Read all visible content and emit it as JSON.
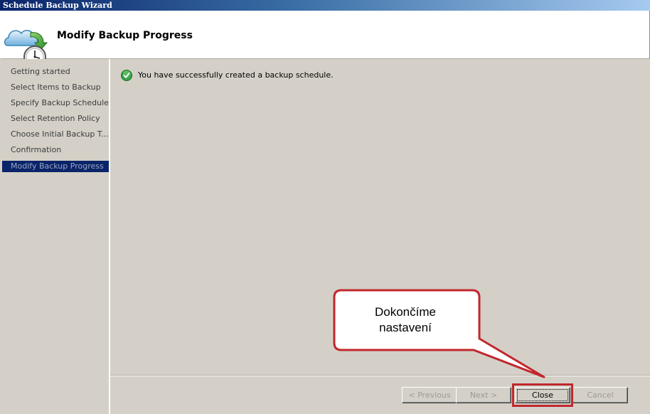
{
  "window": {
    "title": "Schedule Backup Wizard"
  },
  "header": {
    "title": "Modify Backup Progress",
    "icon": "backup-clock-icon"
  },
  "sidebar": {
    "items": [
      {
        "label": "Getting started"
      },
      {
        "label": "Select Items to Backup"
      },
      {
        "label": "Specify Backup Schedule"
      },
      {
        "label": "Select Retention Policy"
      },
      {
        "label": "Choose Initial Backup T..."
      },
      {
        "label": "Confirmation"
      },
      {
        "label": "Modify Backup Progress",
        "active": true
      }
    ]
  },
  "content": {
    "status_icon": "success-check-icon",
    "message": "You have successfully created a backup schedule."
  },
  "buttons": {
    "previous": "< Previous",
    "next": "Next >",
    "close": "Close",
    "cancel": "Cancel"
  },
  "annotation": {
    "line1": "Dokončíme",
    "line2": "nastavení",
    "color": "#c1272d"
  }
}
